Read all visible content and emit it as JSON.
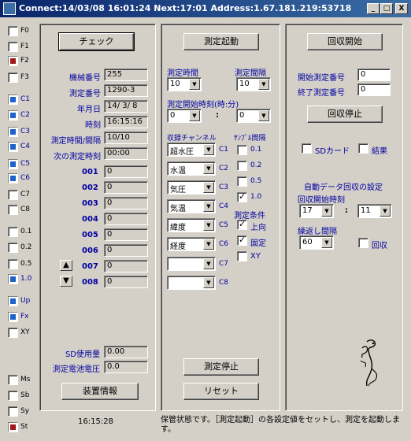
{
  "title": "Connect:14/03/08 16:01:24  Next:17:01  Address:1.67.181.219:53718",
  "window_buttons": [
    "_",
    "□",
    "X"
  ],
  "side": {
    "items": [
      {
        "label": "F0",
        "state": "empty"
      },
      {
        "label": "F1",
        "state": "empty"
      },
      {
        "label": "F2",
        "state": "red"
      },
      {
        "label": "F3",
        "state": "empty"
      },
      {
        "label": "C1",
        "state": "blue"
      },
      {
        "label": "C2",
        "state": "blue"
      },
      {
        "label": "C3",
        "state": "blue"
      },
      {
        "label": "C4",
        "state": "blue"
      },
      {
        "label": "C5",
        "state": "blue"
      },
      {
        "label": "C6",
        "state": "blue"
      },
      {
        "label": "C7",
        "state": "empty"
      },
      {
        "label": "C8",
        "state": "empty"
      },
      {
        "label": "0.1",
        "state": "empty"
      },
      {
        "label": "0.2",
        "state": "empty"
      },
      {
        "label": "0.5",
        "state": "empty"
      },
      {
        "label": "1.0",
        "state": "blue"
      },
      {
        "label": "Up",
        "state": "blue"
      },
      {
        "label": "Fx",
        "state": "blue"
      },
      {
        "label": "XY",
        "state": "empty"
      },
      {
        "label": "Ms",
        "state": "empty"
      },
      {
        "label": "Sb",
        "state": "empty"
      },
      {
        "label": "Sy",
        "state": "empty"
      },
      {
        "label": "St",
        "state": "red"
      }
    ]
  },
  "left": {
    "check_button": "チェック",
    "fields": [
      {
        "label": "機械番号",
        "value": "255"
      },
      {
        "label": "測定番号",
        "value": "1290-3"
      },
      {
        "label": "年月日",
        "value": "14/ 3/ 8"
      },
      {
        "label": "時刻",
        "value": "16:15:16"
      },
      {
        "label": "測定時間/間隔",
        "value": "10/10"
      },
      {
        "label": "次の測定時刻",
        "value": "00:00"
      }
    ],
    "channels": [
      {
        "label": "001",
        "value": "0"
      },
      {
        "label": "002",
        "value": "0"
      },
      {
        "label": "003",
        "value": "0"
      },
      {
        "label": "004",
        "value": "0"
      },
      {
        "label": "005",
        "value": "0"
      },
      {
        "label": "006",
        "value": "0"
      },
      {
        "label": "007",
        "value": "0"
      },
      {
        "label": "008",
        "value": "0"
      }
    ],
    "up_arrow": "▲",
    "down_arrow": "▼",
    "sd_usage_label": "SD使用量",
    "sd_usage_value": "0.00",
    "battery_label": "測定電池電圧",
    "battery_value": "0.0",
    "device_info_button": "装置情報"
  },
  "middle": {
    "start_button": "測定起動",
    "measure_time_label": "測定時間",
    "measure_time_value": "10",
    "measure_interval_label": "測定間隔",
    "measure_interval_value": "10",
    "start_time_label": "測定開始時刻(時:分)",
    "start_hour": "0",
    "colon": ":",
    "start_min": "0",
    "channel_header": "収録チャンネル",
    "sampling_header": "ｻﾝﾌﾟﾙ間隔",
    "channels": [
      {
        "value": "超水圧",
        "code": "C1"
      },
      {
        "value": "水温",
        "code": "C2"
      },
      {
        "value": "気圧",
        "code": "C3"
      },
      {
        "value": "気温",
        "code": "C4"
      },
      {
        "value": "緯度",
        "code": "C5"
      },
      {
        "value": "経度",
        "code": "C6"
      },
      {
        "value": "",
        "code": "C7"
      },
      {
        "value": "",
        "code": "C8"
      }
    ],
    "sampling": [
      {
        "label": "0.1",
        "checked": false
      },
      {
        "label": "0.2",
        "checked": false
      },
      {
        "label": "0.5",
        "checked": false
      },
      {
        "label": "1.0",
        "checked": true
      }
    ],
    "conditions_header": "測定条件",
    "conditions": [
      {
        "label": "上向",
        "checked": true
      },
      {
        "label": "固定",
        "checked": true
      },
      {
        "label": "XY",
        "checked": false
      }
    ],
    "stop_button": "測定停止",
    "reset_button": "リセット"
  },
  "right": {
    "collect_start_button": "回収開始",
    "start_no_label": "開始測定番号",
    "start_no_value": "0",
    "end_no_label": "終了測定番号",
    "end_no_value": "0",
    "collect_stop_button": "回収停止",
    "sd_card_label": "SDカード",
    "result_label": "結果",
    "auto_header": "自動データ回収の設定",
    "collect_time_label": "回収開始時刻",
    "collect_hour": "17",
    "colon": ":",
    "collect_min": "11",
    "repeat_label": "繰返し間隔",
    "repeat_value": "60",
    "collect_label": "回収"
  },
  "statusbar": {
    "time": "16:15:28",
    "message": "保管状態です。［測定起動］の各設定値をセットし、測定を起動します。"
  }
}
